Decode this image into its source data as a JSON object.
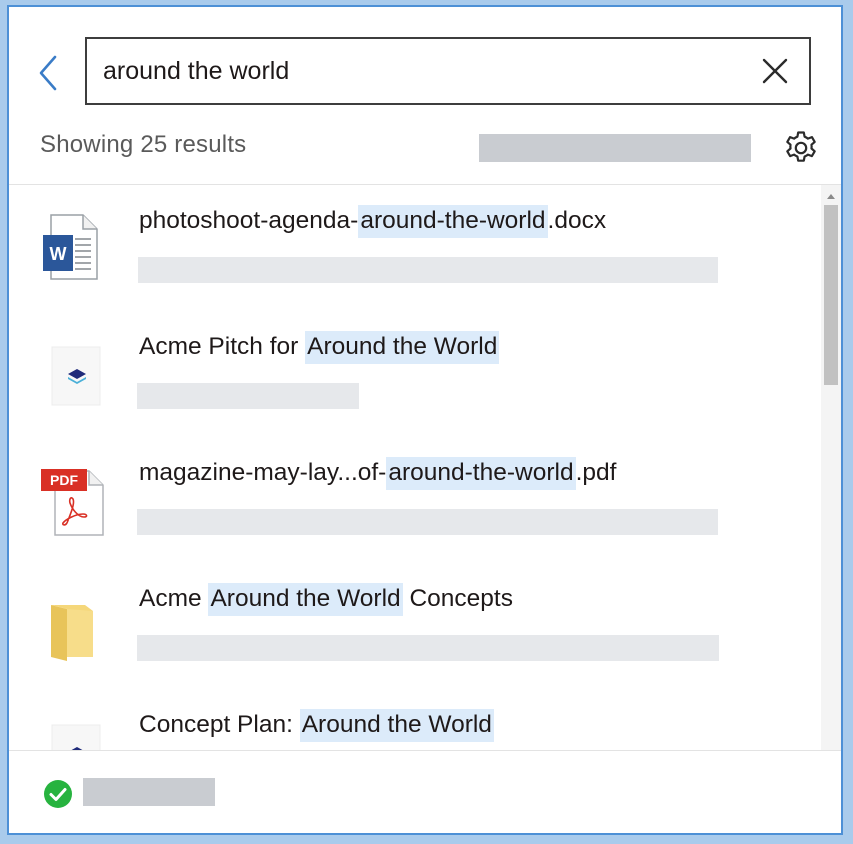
{
  "search": {
    "value": "around the world",
    "back_icon": "chevron-left-icon",
    "clear_icon": "close-icon"
  },
  "results": {
    "count_label": "Showing 25 results",
    "settings_icon": "gear-icon"
  },
  "items": [
    {
      "icon": "word-document-icon",
      "title_pre": "photoshoot-agenda-",
      "title_highlight": "around-the-world",
      "title_post": ".docx"
    },
    {
      "icon": "dropbox-paper-icon",
      "title_pre": "Acme Pitch for ",
      "title_highlight": "Around the World",
      "title_post": ""
    },
    {
      "icon": "pdf-document-icon",
      "pdf_badge": "PDF",
      "title_pre": "magazine-may-lay...of-",
      "title_highlight": "around-the-world",
      "title_post": ".pdf"
    },
    {
      "icon": "folder-icon",
      "title_pre": "Acme ",
      "title_highlight": "Around the World",
      "title_post": " Concepts"
    },
    {
      "icon": "dropbox-paper-icon",
      "title_pre": "Concept Plan: ",
      "title_highlight": "Around the World",
      "title_post": ""
    }
  ],
  "status": {
    "icon": "check-circle-icon",
    "color": "#27b33f"
  },
  "colors": {
    "accent": "#4d90d6",
    "highlight": "#dcebfa",
    "word_blue": "#2b579a",
    "pdf_red": "#d93025",
    "folder_yellow": "#f5d77a"
  }
}
